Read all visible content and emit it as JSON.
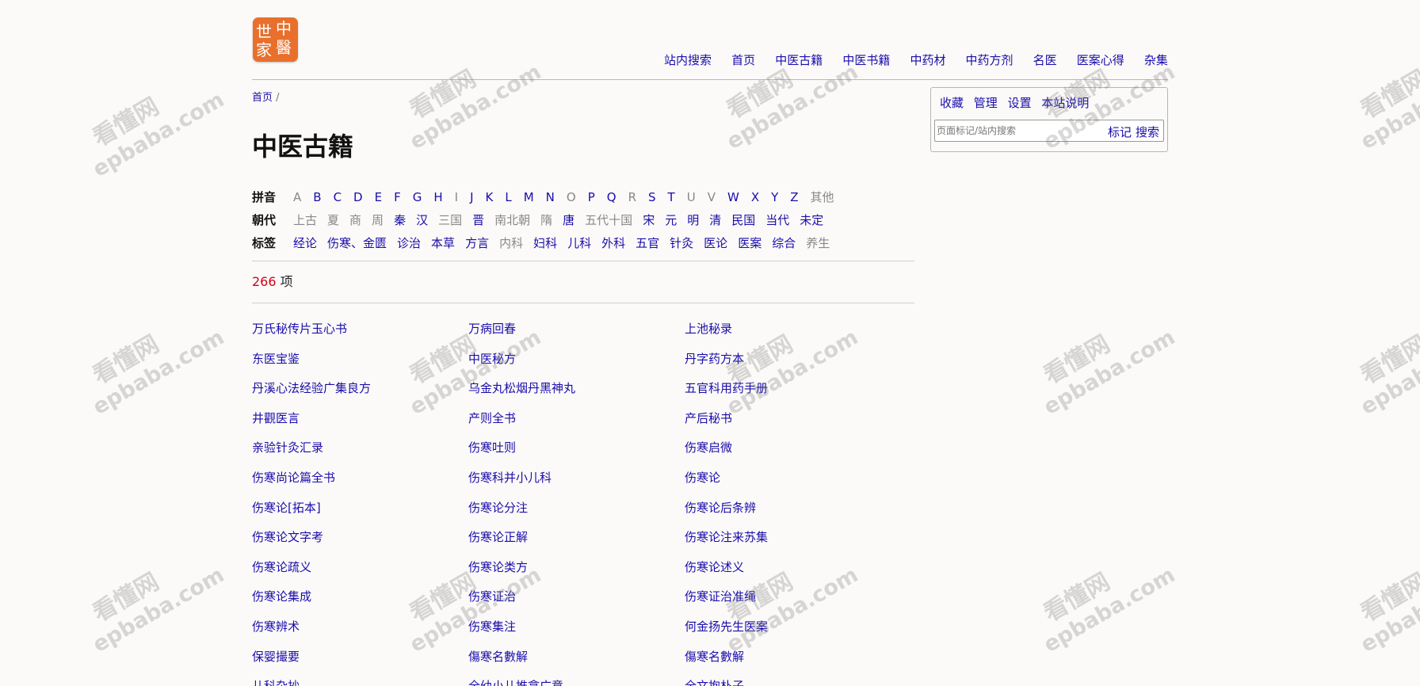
{
  "logo": {
    "chars": [
      "中",
      "醫",
      "世",
      "家"
    ]
  },
  "nav": [
    "站内搜索",
    "首页",
    "中医古籍",
    "中医书籍",
    "中药材",
    "中药方剂",
    "名医",
    "医案心得",
    "杂集"
  ],
  "breadcrumb": {
    "home": "首页",
    "sep": "/"
  },
  "title": "中医古籍",
  "filters": {
    "pinyin": {
      "label": "拼音",
      "items": [
        {
          "t": "A",
          "on": false
        },
        {
          "t": "B",
          "on": true
        },
        {
          "t": "C",
          "on": true
        },
        {
          "t": "D",
          "on": true
        },
        {
          "t": "E",
          "on": true
        },
        {
          "t": "F",
          "on": true
        },
        {
          "t": "G",
          "on": true
        },
        {
          "t": "H",
          "on": true
        },
        {
          "t": "I",
          "on": false
        },
        {
          "t": "J",
          "on": true
        },
        {
          "t": "K",
          "on": true
        },
        {
          "t": "L",
          "on": true
        },
        {
          "t": "M",
          "on": true
        },
        {
          "t": "N",
          "on": true
        },
        {
          "t": "O",
          "on": false
        },
        {
          "t": "P",
          "on": true
        },
        {
          "t": "Q",
          "on": true
        },
        {
          "t": "R",
          "on": false
        },
        {
          "t": "S",
          "on": true
        },
        {
          "t": "T",
          "on": true
        },
        {
          "t": "U",
          "on": false
        },
        {
          "t": "V",
          "on": false
        },
        {
          "t": "W",
          "on": true
        },
        {
          "t": "X",
          "on": true
        },
        {
          "t": "Y",
          "on": true
        },
        {
          "t": "Z",
          "on": true
        },
        {
          "t": "其他",
          "on": false
        }
      ]
    },
    "dynasty": {
      "label": "朝代",
      "items": [
        {
          "t": "上古",
          "on": false
        },
        {
          "t": "夏",
          "on": false
        },
        {
          "t": "商",
          "on": false
        },
        {
          "t": "周",
          "on": false
        },
        {
          "t": "秦",
          "on": true
        },
        {
          "t": "汉",
          "on": true
        },
        {
          "t": "三国",
          "on": false
        },
        {
          "t": "晋",
          "on": true
        },
        {
          "t": "南北朝",
          "on": false
        },
        {
          "t": "隋",
          "on": false
        },
        {
          "t": "唐",
          "on": true
        },
        {
          "t": "五代十国",
          "on": false
        },
        {
          "t": "宋",
          "on": true
        },
        {
          "t": "元",
          "on": true
        },
        {
          "t": "明",
          "on": true
        },
        {
          "t": "清",
          "on": true
        },
        {
          "t": "民国",
          "on": true
        },
        {
          "t": "当代",
          "on": true
        },
        {
          "t": "未定",
          "on": true
        }
      ]
    },
    "tag": {
      "label": "标签",
      "items": [
        {
          "t": "经论",
          "on": true
        },
        {
          "t": "伤寒、金匮",
          "on": true
        },
        {
          "t": "诊治",
          "on": true
        },
        {
          "t": "本草",
          "on": true
        },
        {
          "t": "方言",
          "on": true
        },
        {
          "t": "内科",
          "on": false
        },
        {
          "t": "妇科",
          "on": true
        },
        {
          "t": "儿科",
          "on": true
        },
        {
          "t": "外科",
          "on": true
        },
        {
          "t": "五官",
          "on": true
        },
        {
          "t": "针灸",
          "on": true
        },
        {
          "t": "医论",
          "on": true
        },
        {
          "t": "医案",
          "on": true
        },
        {
          "t": "综合",
          "on": true
        },
        {
          "t": "养生",
          "on": false
        }
      ]
    }
  },
  "count": {
    "num": "266",
    "unit": "项"
  },
  "books": [
    "万氏秘传片玉心书",
    "万病回春",
    "上池秘录",
    "东医宝鉴",
    "中医秘方",
    "丹字药方本",
    "丹溪心法经验广集良方",
    "乌金丸松烟丹黑神丸",
    "五官科用药手册",
    "井觀医言",
    "产则全书",
    "产后秘书",
    "亲验针灸汇录",
    "伤寒吐则",
    "伤寒启微",
    "伤寒尚论篇全书",
    "伤寒科并小儿科",
    "伤寒论",
    "伤寒论[拓本]",
    "伤寒论分注",
    "伤寒论后条辨",
    "伤寒论文字考",
    "伤寒论正解",
    "伤寒论注来苏集",
    "伤寒论疏义",
    "伤寒论类方",
    "伤寒论述义",
    "伤寒论集成",
    "伤寒证治",
    "伤寒证治准绳",
    "伤寒辨术",
    "伤寒集注",
    "何金扬先生医案",
    "保婴撮要",
    "傷寒名數解",
    "傷寒名數解",
    "儿科杂抄",
    "全幼小儿推拿广意",
    "全文抱朴子"
  ],
  "side": {
    "links": [
      "收藏",
      "管理",
      "设置",
      "本站说明"
    ],
    "search_placeholder": "页面标记/站内搜索",
    "mark_btn": "标记",
    "search_btn": "搜索"
  },
  "watermark": {
    "line1": "看懂网",
    "line2": "epbaba.com"
  }
}
